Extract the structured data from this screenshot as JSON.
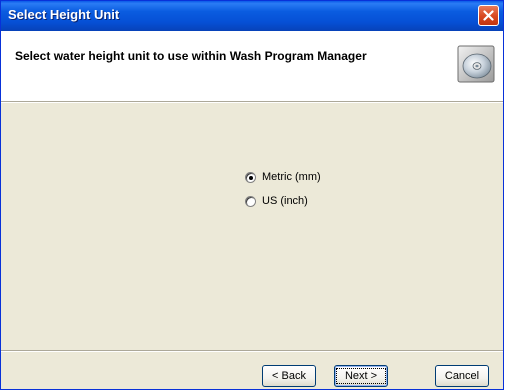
{
  "window": {
    "title": "Select Height Unit",
    "close_icon": "close-icon"
  },
  "header": {
    "instruction": "Select water height unit to use within Wash Program Manager",
    "icon": "cd-disc-icon"
  },
  "options": [
    {
      "label": "Metric (mm)",
      "selected": true
    },
    {
      "label": "US (inch)",
      "selected": false
    }
  ],
  "buttons": {
    "back_label": "< Back",
    "next_label": "Next >",
    "cancel_label": "Cancel"
  },
  "colors": {
    "titlebar": "#0650d6",
    "dialog_background": "#ece9d8",
    "close_button": "#d84820"
  }
}
